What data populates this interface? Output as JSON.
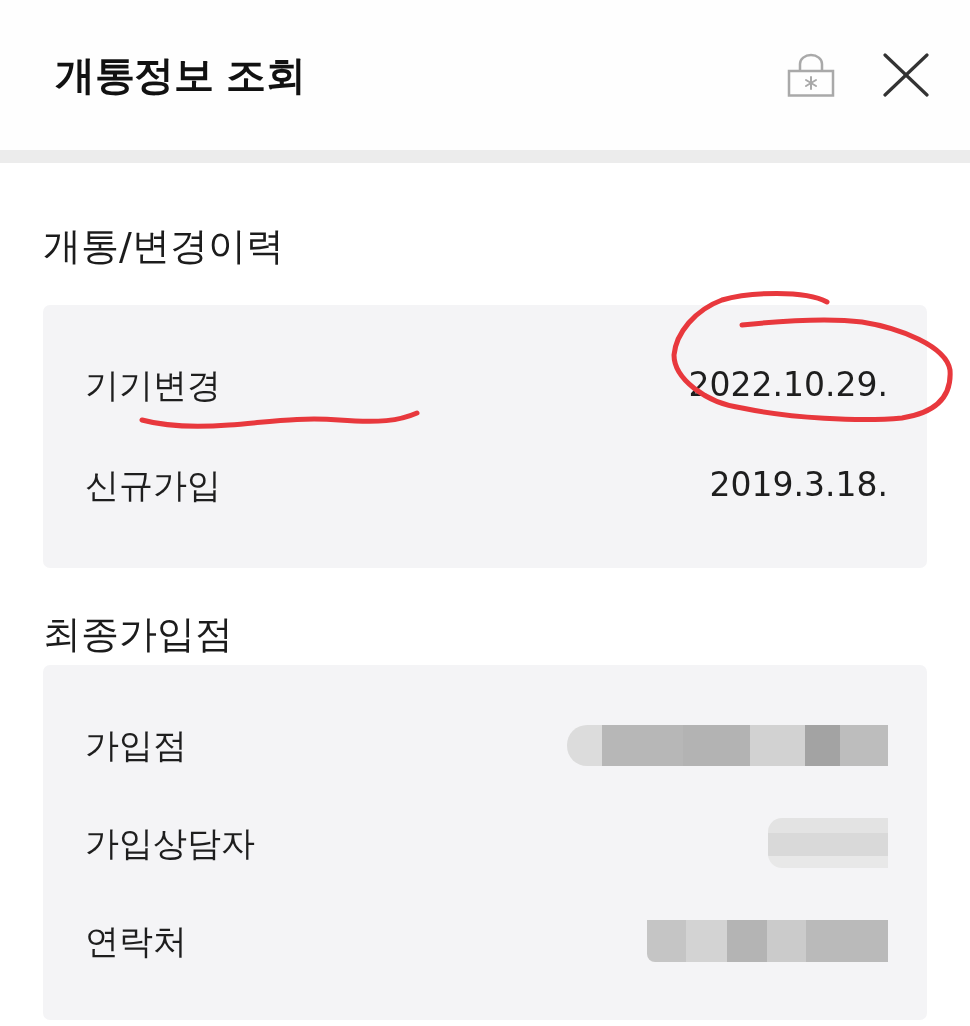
{
  "header": {
    "title": "개통정보 조회"
  },
  "sections": [
    {
      "title": "개통/변경이력",
      "rows": [
        {
          "label": "기기변경",
          "kind": "text",
          "value": "2022.10.29.",
          "underlined": true,
          "circled": true
        },
        {
          "label": "신규가입",
          "kind": "text",
          "value": "2019.3.18.",
          "underlined": false,
          "circled": false
        }
      ]
    },
    {
      "title": "최종가입점",
      "rows": [
        {
          "label": "가입점",
          "kind": "redacted"
        },
        {
          "label": "가입상담자",
          "kind": "redacted"
        },
        {
          "label": "연락처",
          "kind": "redacted"
        }
      ]
    }
  ]
}
